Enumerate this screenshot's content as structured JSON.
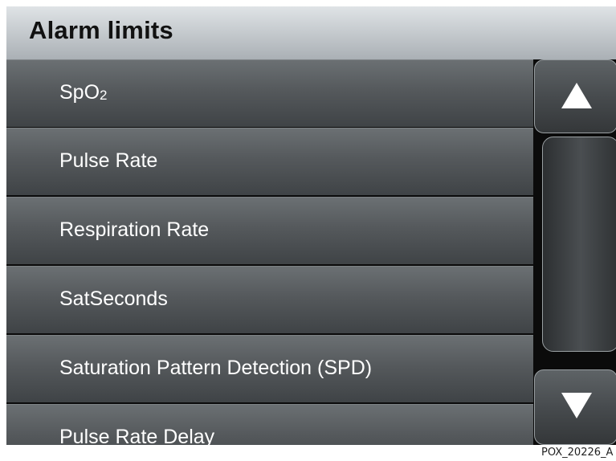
{
  "header": {
    "title": "Alarm limits"
  },
  "menu": {
    "items": [
      {
        "label": "SpO",
        "subscript": "2"
      },
      {
        "label": "Pulse Rate"
      },
      {
        "label": "Respiration Rate"
      },
      {
        "label": "SatSeconds"
      },
      {
        "label": "Saturation Pattern Detection (SPD)"
      },
      {
        "label": "Pulse Rate Delay"
      }
    ]
  },
  "scrollbar": {
    "up_icon": "triangle-up",
    "down_icon": "triangle-down"
  },
  "caption": "POX_20226_A"
}
